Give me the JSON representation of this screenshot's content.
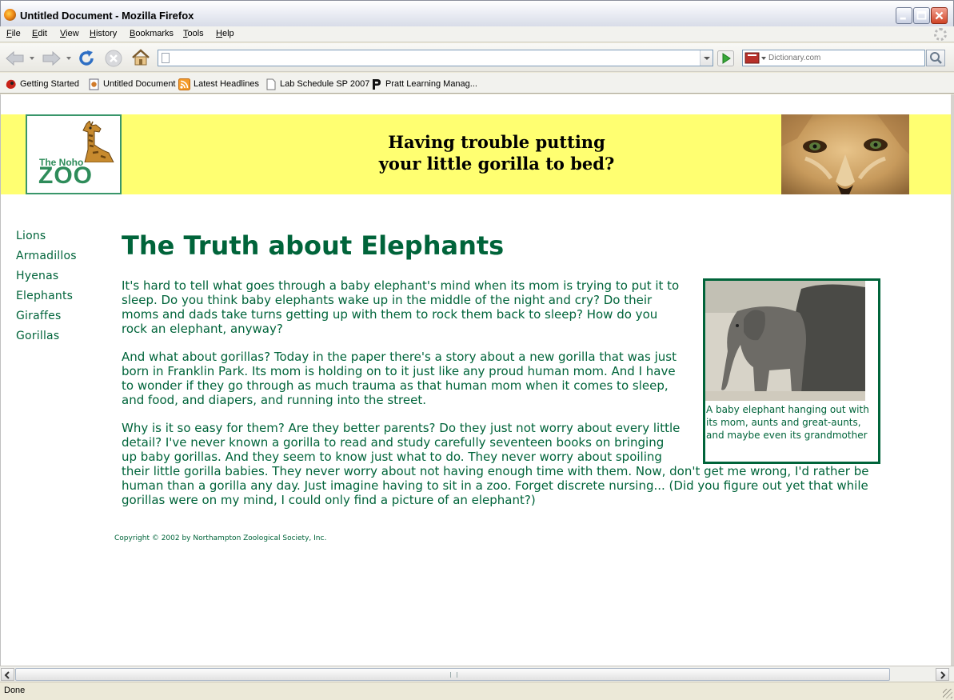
{
  "window": {
    "title": "Untitled Document - Mozilla Firefox"
  },
  "menubar": {
    "items": [
      "File",
      "Edit",
      "View",
      "History",
      "Bookmarks",
      "Tools",
      "Help"
    ]
  },
  "navbar": {
    "url_value": "",
    "search_placeholder": "Dictionary.com",
    "icons": {
      "back": "back-arrow-icon",
      "forward": "forward-arrow-icon",
      "reload": "reload-icon",
      "stop": "stop-icon",
      "home": "home-icon",
      "go": "go-arrow-icon",
      "search": "magnifier-icon"
    }
  },
  "bookmarks": {
    "items": [
      {
        "label": "Getting Started",
        "icon": "firefox-icon"
      },
      {
        "label": "Untitled Document",
        "icon": "page-icon"
      },
      {
        "label": "Latest Headlines",
        "icon": "rss-icon"
      },
      {
        "label": "Lab Schedule SP 2007",
        "icon": "blank-page-icon"
      },
      {
        "label": "Pratt Learning Manag...",
        "icon": "p-letter-icon"
      }
    ]
  },
  "page": {
    "logo": {
      "small": "The Noho",
      "big": "ZOO"
    },
    "tagline": {
      "line1": "Having trouble putting",
      "line2": "your little gorilla to bed?"
    },
    "nav": [
      "Lions",
      "Armadillos",
      "Hyenas",
      "Elephants",
      "Giraffes",
      "Gorillas"
    ],
    "headline": "The Truth about Elephants",
    "paragraphs": [
      "It's hard to tell what goes through a baby elephant's mind when its mom is trying to put it to sleep. Do you think baby elephants wake up in the middle of the night and cry? Do their moms and dads take turns getting up with them to rock them back to sleep? How do you rock an elephant, anyway?",
      "And what about gorillas? Today in the paper there's a story about a new gorilla that was just born in Franklin Park. Its mom is holding on to it just like any proud human mom. And I have to wonder if they go through as much trauma as that human mom when it comes to sleep, and food, and diapers, and running into the street.",
      "Why is it so easy for them? Are they better parents? Do they just not worry about every little detail? I've never known a gorilla to read and study carefully seventeen books on bringing up baby gorillas. And they seem to know just what to do. They never worry about spoiling their little gorilla babies. They never worry about not having enough time with them. Now, don't get me wrong, I'd rather be human than a gorilla any day. Just imagine having to sit in a zoo. Forget discrete nursing... (Did you figure out yet that while gorillas were on my mind, I could only find a picture of an elephant?)"
    ],
    "figure_caption": "A baby elephant hanging out with its mom, aunts and great-aunts, and maybe even its grandmother",
    "copyright": "Copyright © 2002 by Northampton Zoological Society, Inc."
  },
  "statusbar": {
    "text": "Done"
  },
  "colors": {
    "banner": "#ffff71",
    "site_green": "#00643a",
    "logo_green": "#2e8c5a"
  }
}
